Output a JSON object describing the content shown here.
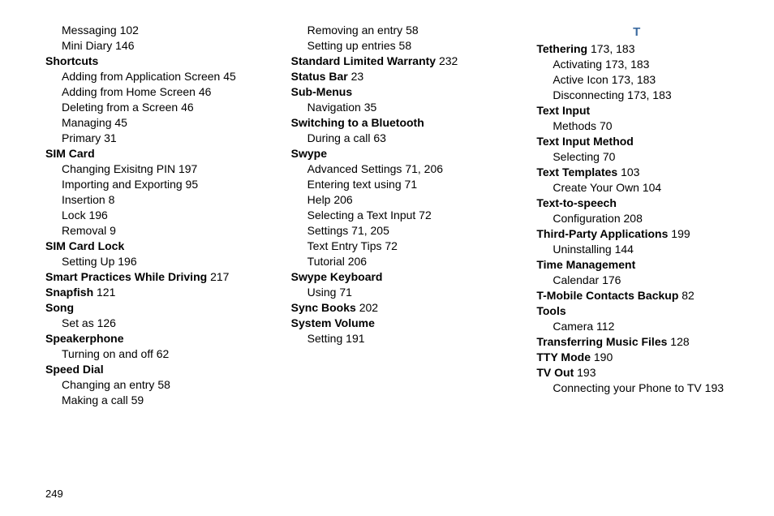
{
  "section_letter": "T",
  "page_number": "249",
  "columns": [
    [
      {
        "type": "sub",
        "label": "Messaging",
        "pages": [
          "102"
        ]
      },
      {
        "type": "sub",
        "label": "Mini Diary",
        "pages": [
          "146"
        ]
      },
      {
        "type": "term",
        "label": "Shortcuts"
      },
      {
        "type": "sub",
        "label": "Adding from Application Screen",
        "pages": [
          "45"
        ]
      },
      {
        "type": "sub",
        "label": "Adding from Home Screen",
        "pages": [
          "46"
        ]
      },
      {
        "type": "sub",
        "label": "Deleting from a Screen",
        "pages": [
          "46"
        ]
      },
      {
        "type": "sub",
        "label": "Managing",
        "pages": [
          "45"
        ]
      },
      {
        "type": "sub",
        "label": "Primary",
        "pages": [
          "31"
        ]
      },
      {
        "type": "term",
        "label": "SIM Card"
      },
      {
        "type": "sub",
        "label": "Changing Exisitng PIN",
        "pages": [
          "197"
        ]
      },
      {
        "type": "sub",
        "label": "Importing and Exporting",
        "pages": [
          "95"
        ]
      },
      {
        "type": "sub",
        "label": "Insertion",
        "pages": [
          "8"
        ]
      },
      {
        "type": "sub",
        "label": "Lock",
        "pages": [
          "196"
        ]
      },
      {
        "type": "sub",
        "label": "Removal",
        "pages": [
          "9"
        ]
      },
      {
        "type": "term",
        "label": "SIM Card Lock"
      },
      {
        "type": "sub",
        "label": "Setting Up",
        "pages": [
          "196"
        ]
      },
      {
        "type": "term",
        "label": "Smart Practices While Driving",
        "pages": [
          "217"
        ]
      },
      {
        "type": "term",
        "label": "Snapfish",
        "pages": [
          "121"
        ]
      },
      {
        "type": "term",
        "label": "Song"
      },
      {
        "type": "sub",
        "label": "Set as",
        "pages": [
          "126"
        ]
      },
      {
        "type": "term",
        "label": "Speakerphone"
      },
      {
        "type": "sub",
        "label": "Turning on and off",
        "pages": [
          "62"
        ]
      },
      {
        "type": "term",
        "label": "Speed Dial"
      },
      {
        "type": "sub",
        "label": "Changing an entry",
        "pages": [
          "58"
        ]
      },
      {
        "type": "sub",
        "label": "Making a call",
        "pages": [
          "59"
        ]
      }
    ],
    [
      {
        "type": "sub",
        "label": "Removing an entry",
        "pages": [
          "58"
        ]
      },
      {
        "type": "sub",
        "label": "Setting up entries",
        "pages": [
          "58"
        ]
      },
      {
        "type": "term",
        "label": "Standard Limited Warranty",
        "pages": [
          "232"
        ]
      },
      {
        "type": "term",
        "label": "Status Bar",
        "pages": [
          "23"
        ]
      },
      {
        "type": "term",
        "label": "Sub-Menus"
      },
      {
        "type": "sub",
        "label": "Navigation",
        "pages": [
          "35"
        ]
      },
      {
        "type": "term",
        "label": "Switching to a Bluetooth"
      },
      {
        "type": "sub",
        "label": "During a call",
        "pages": [
          "63"
        ]
      },
      {
        "type": "term",
        "label": "Swype"
      },
      {
        "type": "sub",
        "label": "Advanced Settings",
        "pages": [
          "71",
          "206"
        ]
      },
      {
        "type": "sub",
        "label": "Entering text using",
        "pages": [
          "71"
        ]
      },
      {
        "type": "sub",
        "label": "Help",
        "pages": [
          "206"
        ]
      },
      {
        "type": "sub",
        "label": "Selecting a Text Input",
        "pages": [
          "72"
        ]
      },
      {
        "type": "sub",
        "label": "Settings",
        "pages": [
          "71",
          "205"
        ]
      },
      {
        "type": "sub",
        "label": "Text Entry Tips",
        "pages": [
          "72"
        ]
      },
      {
        "type": "sub",
        "label": "Tutorial",
        "pages": [
          "206"
        ]
      },
      {
        "type": "term",
        "label": "Swype Keyboard"
      },
      {
        "type": "sub",
        "label": "Using",
        "pages": [
          "71"
        ]
      },
      {
        "type": "term",
        "label": "Sync Books",
        "pages": [
          "202"
        ]
      },
      {
        "type": "term",
        "label": "System Volume"
      },
      {
        "type": "sub",
        "label": "Setting",
        "pages": [
          "191"
        ]
      }
    ],
    [
      {
        "type": "letter"
      },
      {
        "type": "term",
        "label": "Tethering",
        "pages": [
          "173",
          "183"
        ]
      },
      {
        "type": "sub",
        "label": "Activating",
        "pages": [
          "173",
          "183"
        ]
      },
      {
        "type": "sub",
        "label": "Active Icon",
        "pages": [
          "173",
          "183"
        ]
      },
      {
        "type": "sub",
        "label": "Disconnecting",
        "pages": [
          "173",
          "183"
        ]
      },
      {
        "type": "term",
        "label": "Text Input"
      },
      {
        "type": "sub",
        "label": "Methods",
        "pages": [
          "70"
        ]
      },
      {
        "type": "term",
        "label": "Text Input Method"
      },
      {
        "type": "sub",
        "label": "Selecting",
        "pages": [
          "70"
        ]
      },
      {
        "type": "term",
        "label": "Text Templates",
        "pages": [
          "103"
        ]
      },
      {
        "type": "sub",
        "label": "Create Your Own",
        "pages": [
          "104"
        ]
      },
      {
        "type": "term",
        "label": "Text-to-speech"
      },
      {
        "type": "sub",
        "label": "Configuration",
        "pages": [
          "208"
        ]
      },
      {
        "type": "term",
        "label": "Third-Party Applications",
        "pages": [
          "199"
        ]
      },
      {
        "type": "sub",
        "label": "Uninstalling",
        "pages": [
          "144"
        ]
      },
      {
        "type": "term",
        "label": "Time Management"
      },
      {
        "type": "sub",
        "label": "Calendar",
        "pages": [
          "176"
        ]
      },
      {
        "type": "term",
        "label": "T-Mobile Contacts Backup",
        "pages": [
          "82"
        ]
      },
      {
        "type": "term",
        "label": "Tools"
      },
      {
        "type": "sub",
        "label": "Camera",
        "pages": [
          "112"
        ]
      },
      {
        "type": "term",
        "label": "Transferring Music Files",
        "pages": [
          "128"
        ]
      },
      {
        "type": "term",
        "label": "TTY Mode",
        "pages": [
          "190"
        ]
      },
      {
        "type": "term",
        "label": "TV Out",
        "pages": [
          "193"
        ]
      },
      {
        "type": "sub",
        "label": "Connecting your Phone to TV",
        "pages": [
          "193"
        ]
      }
    ]
  ]
}
